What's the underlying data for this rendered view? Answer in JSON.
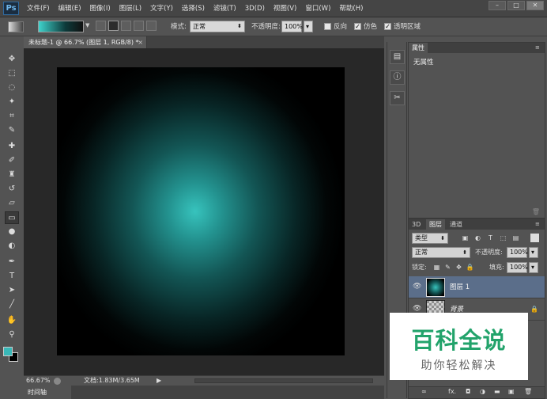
{
  "app": {
    "logo": "Ps",
    "menus": [
      "文件(F)",
      "编辑(E)",
      "图像(I)",
      "图层(L)",
      "文字(Y)",
      "选择(S)",
      "滤镜(T)",
      "3D(D)",
      "视图(V)",
      "窗口(W)",
      "帮助(H)"
    ],
    "window_controls": [
      "–",
      "□",
      "✕"
    ]
  },
  "options_bar": {
    "mode_label": "模式:",
    "mode_value": "正常",
    "opacity_label": "不透明度:",
    "opacity_value": "100%",
    "reverse_label": "反向",
    "dither_label": "仿色",
    "transparency_label": "透明区域",
    "reverse_checked": false,
    "dither_checked": true,
    "transparency_checked": true
  },
  "document": {
    "tab_title": "未标题-1 @ 66.7% (图层 1, RGB/8) *",
    "close": "×",
    "canvas_center_color": "#37c3bd",
    "canvas_edge_color": "#000000"
  },
  "toolbar": {
    "tools": [
      {
        "name": "move-tool",
        "glyph": "✥"
      },
      {
        "name": "marquee-tool",
        "glyph": "⬚"
      },
      {
        "name": "lasso-tool",
        "glyph": "◌"
      },
      {
        "name": "magic-wand-tool",
        "glyph": "✦"
      },
      {
        "name": "crop-tool",
        "glyph": "⌗"
      },
      {
        "name": "eyedropper-tool",
        "glyph": "✎"
      },
      {
        "name": "healing-tool",
        "glyph": "✚"
      },
      {
        "name": "brush-tool",
        "glyph": "✐"
      },
      {
        "name": "stamp-tool",
        "glyph": "♜"
      },
      {
        "name": "history-brush-tool",
        "glyph": "↺"
      },
      {
        "name": "eraser-tool",
        "glyph": "▱"
      },
      {
        "name": "gradient-tool",
        "glyph": "▭"
      },
      {
        "name": "blur-tool",
        "glyph": "●"
      },
      {
        "name": "dodge-tool",
        "glyph": "◐"
      },
      {
        "name": "pen-tool",
        "glyph": "✒"
      },
      {
        "name": "type-tool",
        "glyph": "T"
      },
      {
        "name": "path-selection-tool",
        "glyph": "➤"
      },
      {
        "name": "line-tool",
        "glyph": "╱"
      },
      {
        "name": "hand-tool",
        "glyph": "✋"
      },
      {
        "name": "zoom-tool",
        "glyph": "⚲"
      }
    ],
    "foreground_color": "#39b8b8",
    "background_color": "#000000"
  },
  "status_bar": {
    "zoom": "66.67%",
    "doc_info": "文档:1.83M/3.65M",
    "arrow": "▶"
  },
  "timeline": {
    "label": "时间轴"
  },
  "properties_panel": {
    "tab": "属性",
    "content": "无属性"
  },
  "layers_panel": {
    "tabs": [
      "3D",
      "图层",
      "通道"
    ],
    "filter_kind": "类型",
    "blend_mode": "正常",
    "opacity_label": "不透明度:",
    "opacity_value": "100%",
    "lock_label": "锁定:",
    "fill_label": "填充:",
    "fill_value": "100%",
    "layers": [
      {
        "name": "图层 1",
        "selected": true
      },
      {
        "name": "背景",
        "selected": false,
        "locked": true
      }
    ],
    "footer_icons": [
      "∞",
      "fx.",
      "◘",
      "◑",
      "▬",
      "▣",
      "🗑"
    ]
  },
  "watermark": {
    "title": "百科全说",
    "subtitle": "助你轻松解决"
  }
}
